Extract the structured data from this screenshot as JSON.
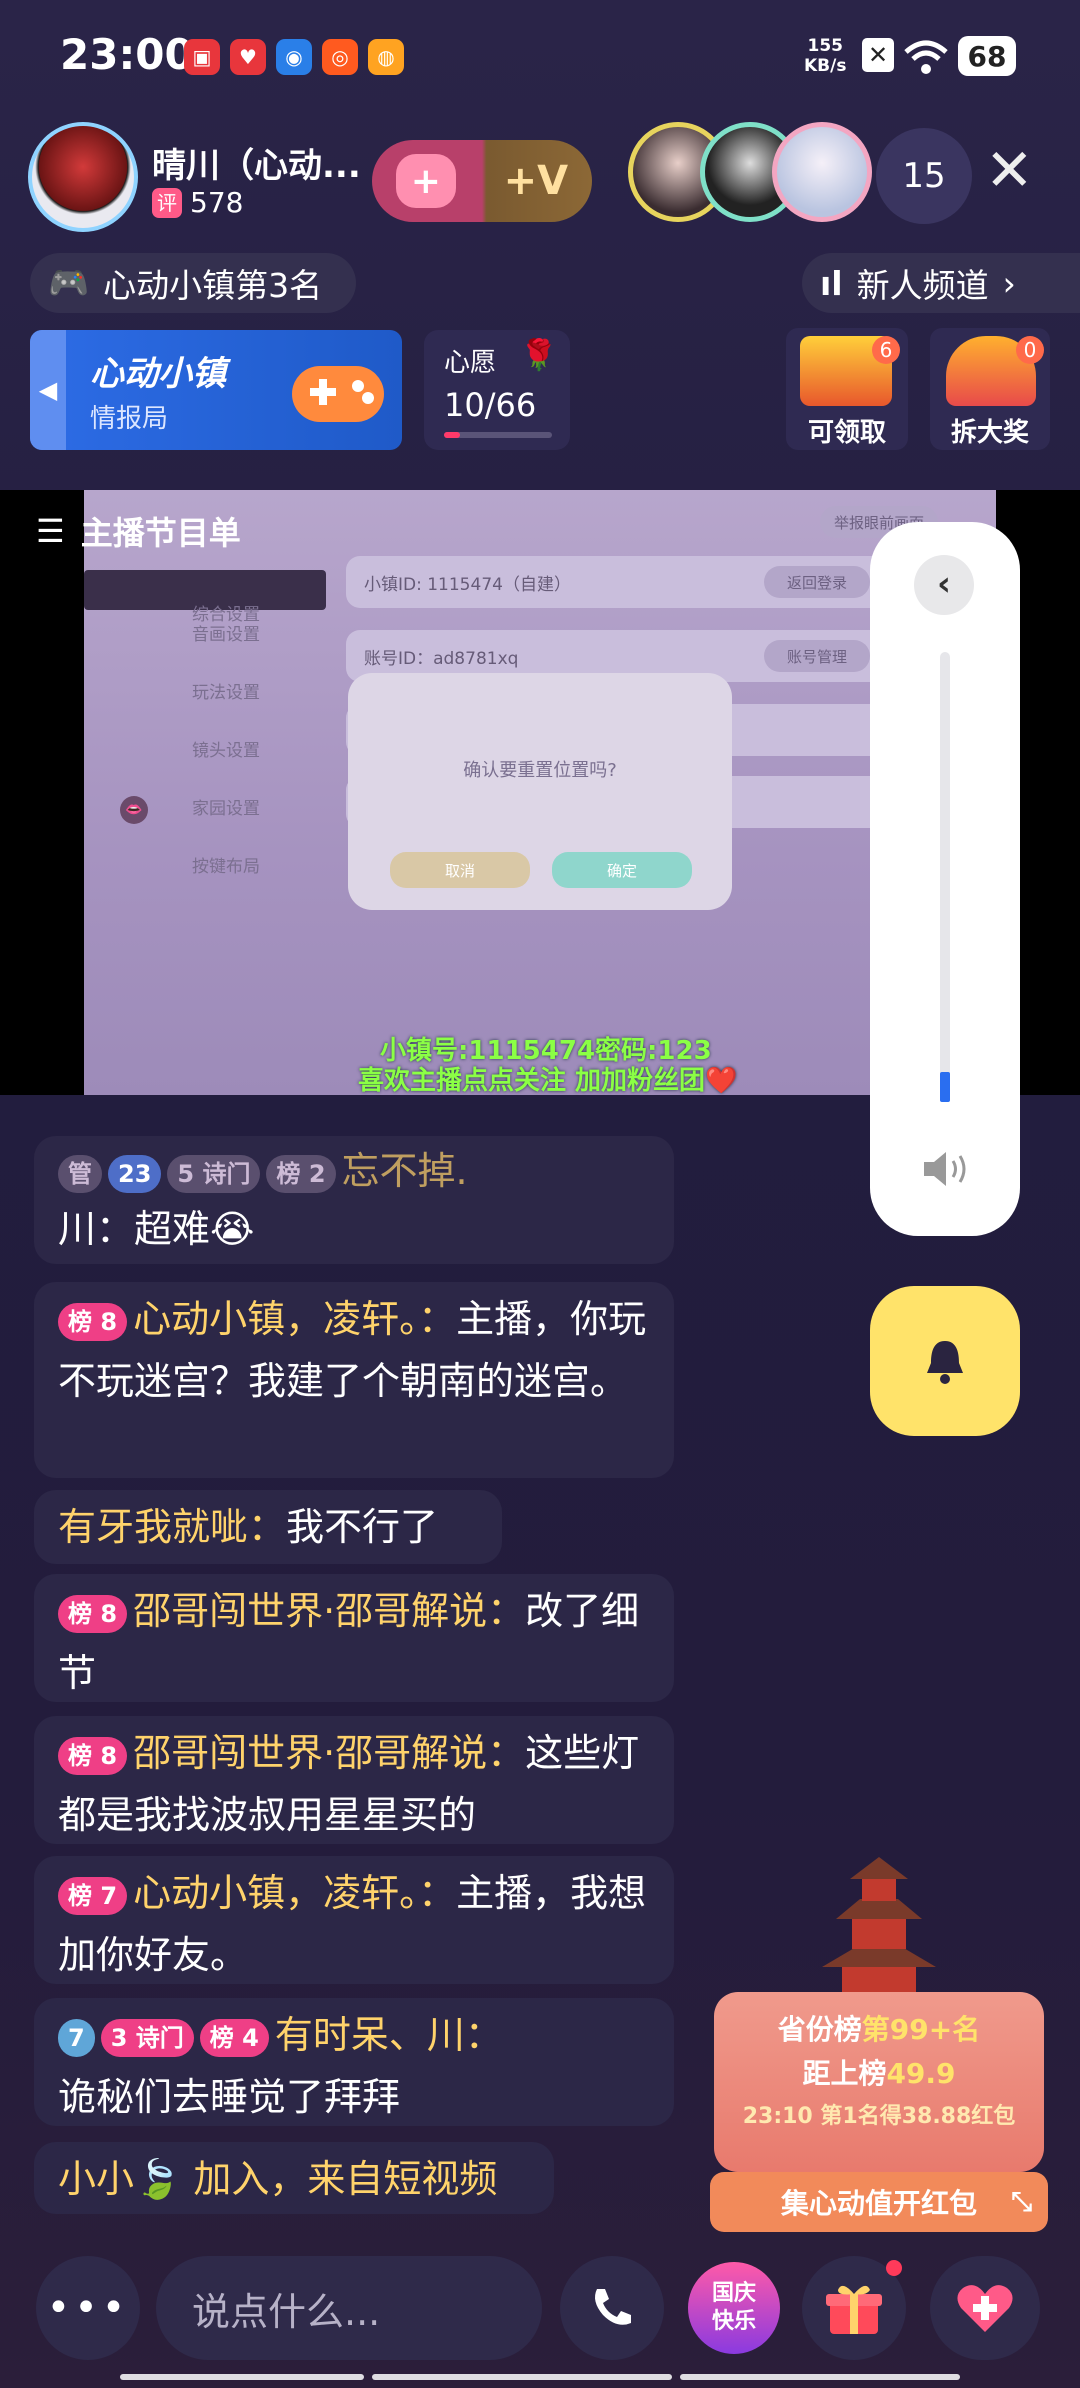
{
  "status": {
    "time": "23:00",
    "net_speed": "155",
    "net_unit": "KB/s",
    "battery": "68"
  },
  "host": {
    "name": "晴川（心动...",
    "rating_badge": "评",
    "score": "578",
    "follow_icon": "+",
    "vip_label": "+V"
  },
  "viewers": {
    "count": "15"
  },
  "tags": {
    "rank": "心动小镇第3名",
    "channel": "新人频道"
  },
  "town_card": {
    "title": "心动小镇",
    "subtitle": "情报局"
  },
  "wish": {
    "label": "心愿",
    "value": "10/66",
    "progress": 0.15
  },
  "chests": [
    {
      "label": "可领取",
      "count": "6"
    },
    {
      "label": "拆大奖",
      "count": "0"
    }
  ],
  "video": {
    "program_title": "主播节目单",
    "top_btn": "举报眼前画面",
    "side_menu": [
      "综合设置",
      "音画设置",
      "玩法设置",
      "镜头设置",
      "家园设置",
      "按键布局"
    ],
    "rows": [
      {
        "text": "小镇ID:  1115474（自建）",
        "btn": "返回登录"
      },
      {
        "text": "账号ID：ad8781xq",
        "btn": "账号管理"
      }
    ],
    "dialog": {
      "text": "确认要重置位置吗?",
      "cancel": "取消",
      "ok": "确定"
    },
    "banner1": "小镇号:1115474密码:123",
    "banner2": "喜欢主播点点关注 加加粉丝团❤️"
  },
  "chat": [
    {
      "badges": [
        {
          "t": "管",
          "c": "b-gray"
        },
        {
          "t": "23",
          "c": "b-blue"
        },
        {
          "t": "5 诗门",
          "c": "b-gray"
        },
        {
          "t": "榜 2",
          "c": "b-gray"
        }
      ],
      "name": "忘不掉.",
      "text": "川：超难😭"
    },
    {
      "badges": [
        {
          "t": "榜 8",
          "c": "b-rank"
        }
      ],
      "name": "心动小镇，凌轩。：",
      "text": "主播，你玩不玩迷宫？我建了个朝南的迷宫。"
    },
    {
      "badges": [],
      "name": "有牙我就呲：",
      "text": "我不行了"
    },
    {
      "badges": [
        {
          "t": "榜 8",
          "c": "b-rank"
        }
      ],
      "name": "邵哥闯世界·邵哥解说：",
      "text": "改了细节"
    },
    {
      "badges": [
        {
          "t": "榜 8",
          "c": "b-rank"
        }
      ],
      "name": "邵哥闯世界·邵哥解说：",
      "text": "这些灯都是我找波叔用星星买的"
    },
    {
      "badges": [
        {
          "t": "榜 7",
          "c": "b-rank"
        }
      ],
      "name": "心动小镇，凌轩。：",
      "text": "主播，我想加你好友。"
    },
    {
      "badges": [
        {
          "t": "7",
          "c": "b-diam"
        },
        {
          "t": "3 诗门",
          "c": "b-rank"
        },
        {
          "t": "榜 4",
          "c": "b-rank"
        }
      ],
      "name": "有时呆、川：",
      "text": "诡秘们去睡觉了拜拜"
    },
    {
      "badges": [],
      "name": "小小🍃",
      "text": "加入，来自短视频"
    }
  ],
  "province": {
    "line1a": "省份榜",
    "line1b": "第99+名",
    "line2a": "距上榜",
    "line2b": "49.9",
    "line3": "23:10 第1名得38.88红包",
    "button": "集心动值开红包"
  },
  "input": {
    "placeholder": "说点什么..."
  },
  "festival": {
    "text": "国庆快乐"
  }
}
